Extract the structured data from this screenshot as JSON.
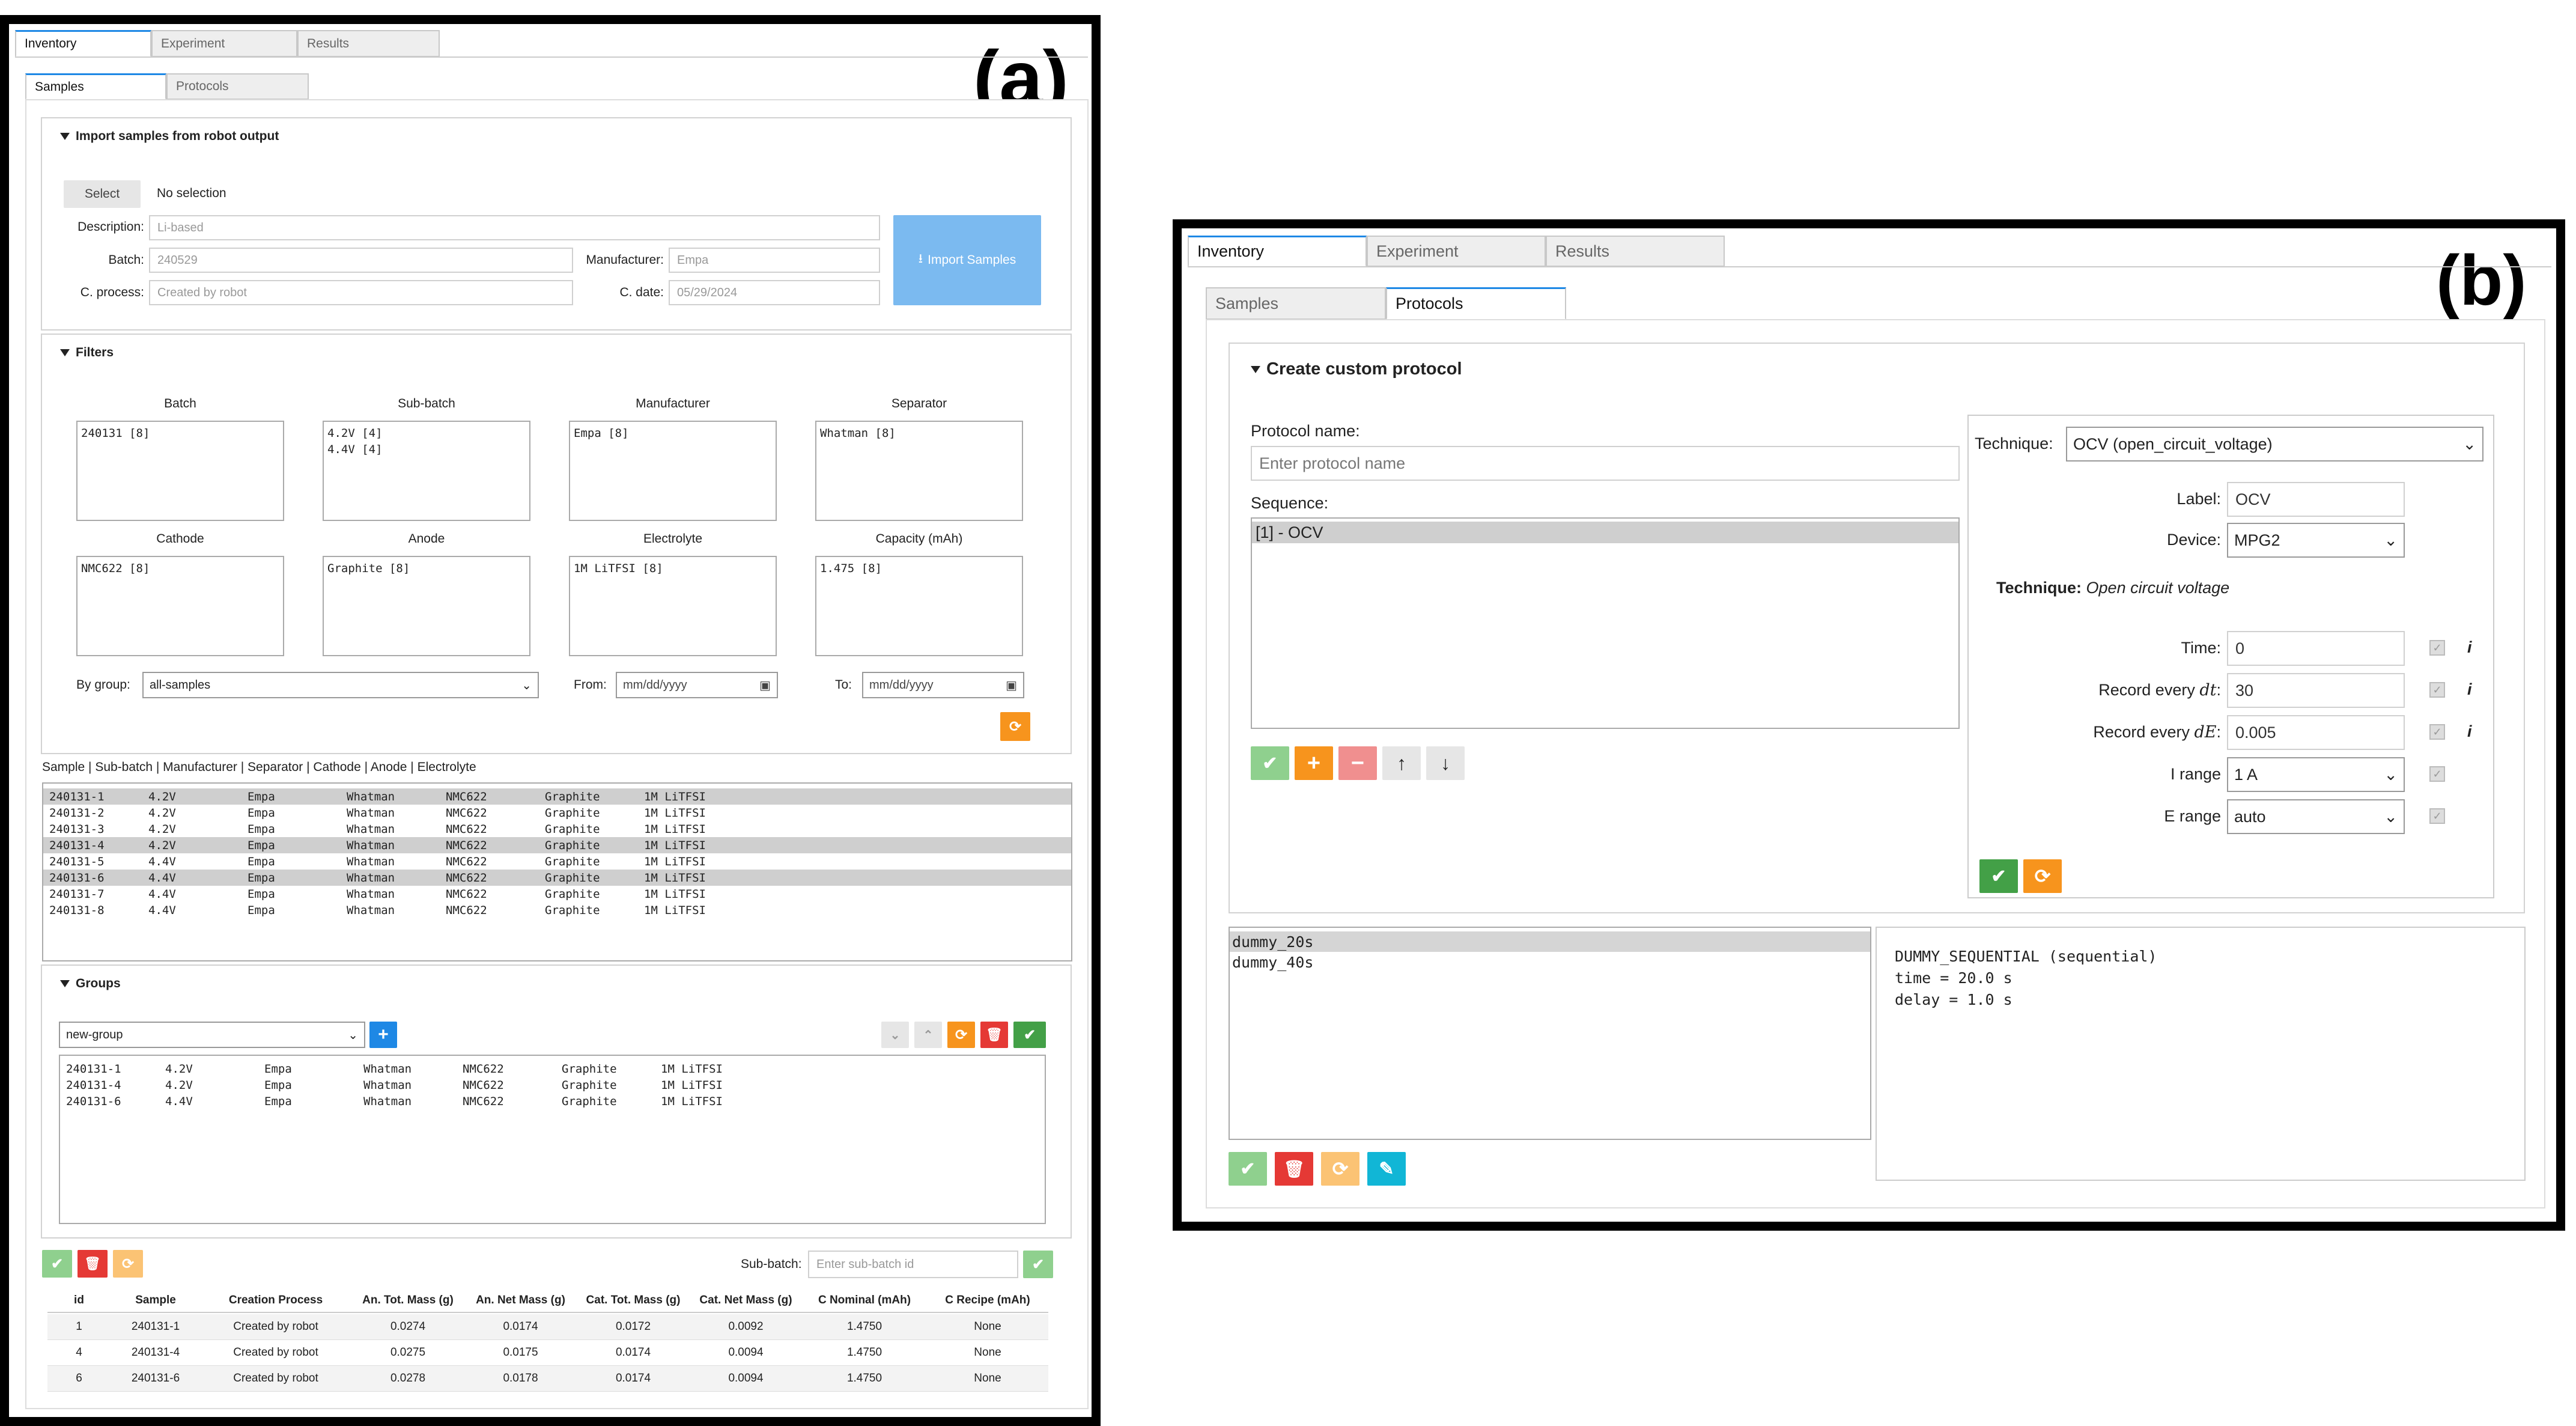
{
  "panel_a": {
    "letter": "(a)",
    "tabs": [
      "Inventory",
      "Experiment",
      "Results"
    ],
    "subtabs": [
      "Samples",
      "Protocols"
    ],
    "import": {
      "title": "Import samples from robot output",
      "select_btn": "Select",
      "no_selection": "No selection",
      "desc_label": "Description:",
      "desc_ph": "Li-based",
      "batch_label": "Batch:",
      "batch_ph": "240529",
      "manu_label": "Manufacturer:",
      "manu_ph": "Empa",
      "cproc_label": "C. process:",
      "cproc_ph": "Created by robot",
      "cdate_label": "C. date:",
      "cdate_ph": "05/29/2024",
      "import_btn": "Import Samples"
    },
    "filters": {
      "title": "Filters",
      "boxes": [
        {
          "label": "Batch",
          "content": "240131 [8]"
        },
        {
          "label": "Sub-batch",
          "content": "4.2V [4]\n4.4V [4]"
        },
        {
          "label": "Manufacturer",
          "content": "Empa [8]"
        },
        {
          "label": "Separator",
          "content": "Whatman [8]"
        },
        {
          "label": "Cathode",
          "content": "NMC622 [8]"
        },
        {
          "label": "Anode",
          "content": "Graphite [8]"
        },
        {
          "label": "Electrolyte",
          "content": "1M LiTFSI [8]"
        },
        {
          "label": "Capacity (mAh)",
          "content": "1.475 [8]"
        }
      ],
      "bygroup_label": "By group:",
      "bygroup_value": "all-samples",
      "from_label": "From:",
      "to_label": "To:",
      "date_ph": "mm/dd/yyyy"
    },
    "list_header": "Sample | Sub-batch | Manufacturer | Separator | Cathode | Anode | Electrolyte",
    "samples": [
      [
        "240131-1",
        "4.2V",
        "Empa",
        "Whatman",
        "NMC622",
        "Graphite",
        "1M LiTFSI"
      ],
      [
        "240131-2",
        "4.2V",
        "Empa",
        "Whatman",
        "NMC622",
        "Graphite",
        "1M LiTFSI"
      ],
      [
        "240131-3",
        "4.2V",
        "Empa",
        "Whatman",
        "NMC622",
        "Graphite",
        "1M LiTFSI"
      ],
      [
        "240131-4",
        "4.2V",
        "Empa",
        "Whatman",
        "NMC622",
        "Graphite",
        "1M LiTFSI"
      ],
      [
        "240131-5",
        "4.4V",
        "Empa",
        "Whatman",
        "NMC622",
        "Graphite",
        "1M LiTFSI"
      ],
      [
        "240131-6",
        "4.4V",
        "Empa",
        "Whatman",
        "NMC622",
        "Graphite",
        "1M LiTFSI"
      ],
      [
        "240131-7",
        "4.4V",
        "Empa",
        "Whatman",
        "NMC622",
        "Graphite",
        "1M LiTFSI"
      ],
      [
        "240131-8",
        "4.4V",
        "Empa",
        "Whatman",
        "NMC622",
        "Graphite",
        "1M LiTFSI"
      ]
    ],
    "selected_rows": [
      0,
      3,
      5
    ],
    "groups": {
      "title": "Groups",
      "select_value": "new-group",
      "members": [
        [
          "240131-1",
          "4.2V",
          "Empa",
          "Whatman",
          "NMC622",
          "Graphite",
          "1M LiTFSI"
        ],
        [
          "240131-4",
          "4.2V",
          "Empa",
          "Whatman",
          "NMC622",
          "Graphite",
          "1M LiTFSI"
        ],
        [
          "240131-6",
          "4.4V",
          "Empa",
          "Whatman",
          "NMC622",
          "Graphite",
          "1M LiTFSI"
        ]
      ]
    },
    "subbatch_label": "Sub-batch:",
    "subbatch_ph": "Enter sub-batch id",
    "table": {
      "headers": [
        "id",
        "Sample",
        "Creation Process",
        "An. Tot. Mass (g)",
        "An. Net Mass (g)",
        "Cat. Tot. Mass (g)",
        "Cat. Net Mass (g)",
        "C Nominal (mAh)",
        "C Recipe (mAh)"
      ],
      "rows": [
        [
          "1",
          "240131-1",
          "Created by robot",
          "0.0274",
          "0.0174",
          "0.0172",
          "0.0092",
          "1.4750",
          "None"
        ],
        [
          "4",
          "240131-4",
          "Created by robot",
          "0.0275",
          "0.0175",
          "0.0174",
          "0.0094",
          "1.4750",
          "None"
        ],
        [
          "6",
          "240131-6",
          "Created by robot",
          "0.0278",
          "0.0178",
          "0.0174",
          "0.0094",
          "1.4750",
          "None"
        ]
      ]
    }
  },
  "panel_b": {
    "letter": "(b)",
    "tabs": [
      "Inventory",
      "Experiment",
      "Results"
    ],
    "subtabs": [
      "Samples",
      "Protocols"
    ],
    "title": "Create custom protocol",
    "name_label": "Protocol name:",
    "name_ph": "Enter protocol name",
    "seq_label": "Sequence:",
    "sequence": [
      "[1] - OCV"
    ],
    "technique_label": "Technique:",
    "technique_value": "OCV (open_circuit_voltage)",
    "label_label": "Label:",
    "label_value": "OCV",
    "device_label": "Device:",
    "device_value": "MPG2",
    "tech_desc_label": "Technique:",
    "tech_desc": "Open circuit voltage",
    "params": [
      {
        "label": "Time:",
        "value": "0",
        "kind": "input"
      },
      {
        "label": "Record every dt:",
        "value": "30",
        "kind": "input"
      },
      {
        "label": "Record every dE:",
        "value": "0.005",
        "kind": "input"
      },
      {
        "label": "I range",
        "value": "1 A",
        "kind": "select"
      },
      {
        "label": "E range",
        "value": "auto",
        "kind": "select"
      }
    ],
    "info_glyph": "i",
    "protocols": [
      "dummy_20s",
      "dummy_40s"
    ],
    "detail": [
      "DUMMY_SEQUENTIAL (sequential)",
      "time = 20.0 s",
      "delay = 1.0 s"
    ]
  }
}
